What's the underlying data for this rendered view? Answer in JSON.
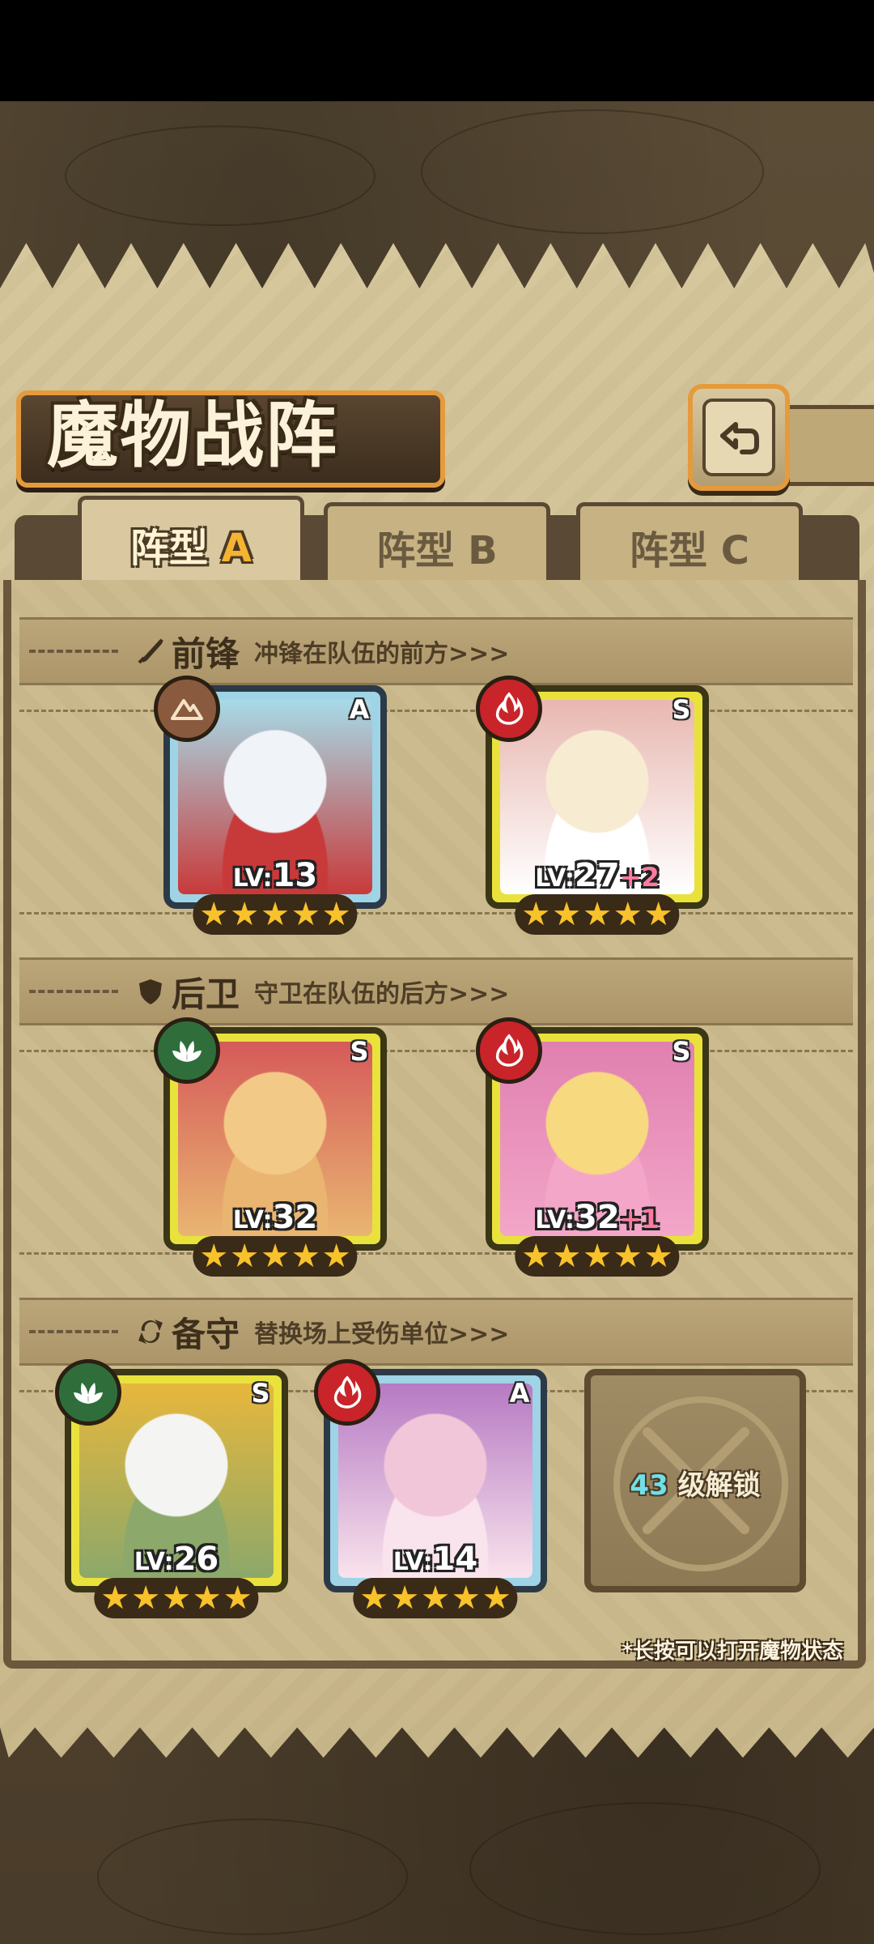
{
  "header": {
    "title": "魔物战阵",
    "back_icon": "back-return-icon"
  },
  "tabs": [
    {
      "label": "阵型",
      "suffix": "A",
      "active": true
    },
    {
      "label": "阵型",
      "suffix": "B",
      "active": false
    },
    {
      "label": "阵型",
      "suffix": "C",
      "active": false
    }
  ],
  "sections": {
    "front": {
      "title": "前锋",
      "desc": "冲锋在队伍的前方>>>",
      "icon": "sword-icon"
    },
    "rear": {
      "title": "后卫",
      "desc": "守卫在队伍的后方>>>",
      "icon": "shield-icon"
    },
    "reserve": {
      "title": "备守",
      "desc": "替换场上受伤单位>>>",
      "icon": "swap-icon"
    }
  },
  "cards": {
    "front": [
      {
        "rank": "A",
        "element": "earth",
        "lv_label": "LV:",
        "level": "13",
        "plus": "",
        "stars": 5,
        "palette": [
          "#f0f3f7",
          "#c83a3a",
          "#2b2b33",
          "#a6dbe8"
        ]
      },
      {
        "rank": "S",
        "element": "fire",
        "lv_label": "LV:",
        "level": "27",
        "plus": "+2",
        "stars": 5,
        "palette": [
          "#f7ecd2",
          "#ffffff",
          "#6ba3d4",
          "#e8b7b0"
        ]
      }
    ],
    "rear": [
      {
        "rank": "S",
        "element": "grass",
        "lv_label": "LV:",
        "level": "32",
        "plus": "",
        "stars": 5,
        "palette": [
          "#f3c988",
          "#e9b571",
          "#c9d6e0",
          "#d65a5a"
        ]
      },
      {
        "rank": "S",
        "element": "fire",
        "lv_label": "LV:",
        "level": "32",
        "plus": "+1",
        "stars": 5,
        "palette": [
          "#f7d97f",
          "#f3a6c8",
          "#6b73c8",
          "#e080b0"
        ]
      }
    ],
    "reserve": [
      {
        "rank": "S",
        "element": "grass",
        "lv_label": "LV:",
        "level": "26",
        "plus": "",
        "stars": 5,
        "palette": [
          "#f4f5f2",
          "#8ca86a",
          "#d7dbe0",
          "#e7b73c"
        ]
      },
      {
        "rank": "A",
        "element": "fire",
        "lv_label": "LV:",
        "level": "14",
        "plus": "",
        "stars": 5,
        "palette": [
          "#f1c6d8",
          "#f9e3ec",
          "#c34260",
          "#b67ac4"
        ]
      }
    ]
  },
  "locked_slot": {
    "level": "43",
    "text": "级解锁"
  },
  "footer_hint": "*长按可以打开魔物状态",
  "colors": {
    "accent_orange": "#e59a3c",
    "star": "#f7c22b",
    "rank_a": "#9fd3e6",
    "rank_s": "#e9e23d"
  }
}
